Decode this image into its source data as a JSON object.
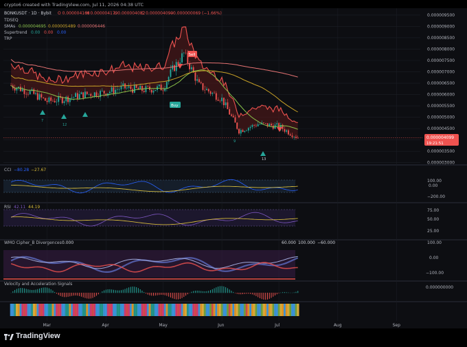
{
  "caption": "crypto6 created with TradingView.com, Jul 11, 2026 04:38 UTC",
  "brand": "TradingView",
  "header": {
    "symbol": "BONKUSDT · 1D · Bybit",
    "o": "O 0.000004168",
    "h": "H 0.000004179",
    "l": "L 0.000004082",
    "c": "C 0.000004099",
    "chg": "−0.000000069 (−1.66%)"
  },
  "legend": {
    "td": "TDSEQ",
    "sma_name": "SMAs",
    "sma_values": [
      "0.000004695",
      "0.000005489",
      "0.000006446"
    ],
    "st_name": "Supertrend",
    "st_values": [
      "0.00",
      "0.00",
      "0.00"
    ],
    "trp": "TRP",
    "cci": "CCI",
    "cci_values": [
      "−80.28",
      "−27.67"
    ],
    "rsi": "RSI",
    "rsi_values": [
      "42.11",
      "44.19"
    ],
    "wmo": "WMO Cipher_B Divergences",
    "wmo_values": [
      "0.000",
      "100.000",
      "−60.000",
      "60.000"
    ],
    "vel": "Velocity and Acceleration Signals"
  },
  "price_axis": [
    "0.000009500",
    "0.000009000",
    "0.000008500",
    "0.000008000",
    "0.000007500",
    "0.000007000",
    "0.000006500",
    "0.000006000",
    "0.000005500",
    "0.000005000",
    "0.000004500",
    "0.000004000",
    "0.000003500",
    "0.000003000"
  ],
  "last_price": "0.000004099",
  "countdown": "19:21:51",
  "cci_axis": [
    "100.00",
    "0.00",
    "−200.00"
  ],
  "rsi_axis": [
    "75.00",
    "50.00",
    "25.00"
  ],
  "wmo_axis": [
    "100.00",
    "0.00",
    "−100.00"
  ],
  "vel_axis": "0.000000000",
  "x_axis": [
    "Mar",
    "Apr",
    "May",
    "Jun",
    "Jul",
    "Aug",
    "Sep"
  ],
  "signals": {
    "buy": "Buy",
    "sell": "Sell",
    "td_counts": [
      "7",
      "12",
      "9",
      "13"
    ]
  },
  "colors": {
    "up": "#26a69a",
    "down": "#ef5350",
    "sma_fast": "#8bc34a",
    "sma_mid": "#c9a227",
    "sma_slow": "#e57373",
    "cci": "#2962ff",
    "rsi": "#7e57c2",
    "avg": "#d4b83a"
  },
  "chart_data": {
    "type": "line",
    "title": "BONKUSDT · 1D · Bybit",
    "x": [
      "2026-02-10",
      "2026-02-20",
      "2026-03-01",
      "2026-03-10",
      "2026-03-20",
      "2026-04-01",
      "2026-04-10",
      "2026-04-20",
      "2026-05-01",
      "2026-05-06",
      "2026-05-12",
      "2026-05-20",
      "2026-06-01",
      "2026-06-10",
      "2026-06-20",
      "2026-07-01",
      "2026-07-11"
    ],
    "series": [
      {
        "name": "BONKUSDT",
        "values": [
          6.4e-06,
          6.1e-06,
          5.7e-06,
          5.8e-06,
          6e-06,
          6.1e-06,
          6.3e-06,
          6.2e-06,
          6.3e-06,
          7.1e-06,
          7.8e-06,
          6.4e-06,
          5.8e-06,
          4.4e-06,
          4.7e-06,
          4.6e-06,
          4.1e-06
        ]
      }
    ],
    "ylim": [
      2.9e-06,
      9.8e-06
    ],
    "xlabel": "",
    "ylabel": ""
  }
}
